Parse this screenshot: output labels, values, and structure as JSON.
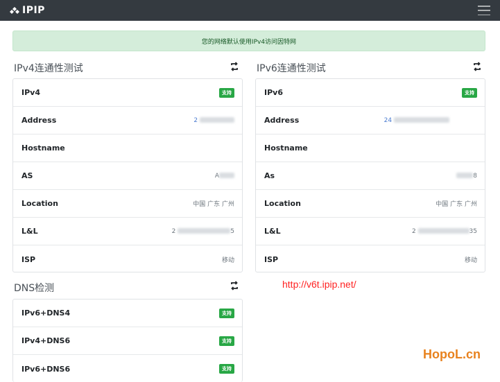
{
  "navbar": {
    "brand": "IPIP",
    "brand_icon": "ipip-logo-icon",
    "menu_icon": "hamburger-icon"
  },
  "alert": {
    "text": "您的网络默认使用IPv4访问因特网",
    "bg": "#d4edda",
    "color": "#155724"
  },
  "ipv4": {
    "title": "IPv4连通性测试",
    "rows": [
      {
        "key": "IPv4",
        "badge": "支持"
      },
      {
        "key": "Address",
        "value": "2"
      },
      {
        "key": "Hostname",
        "value": ""
      },
      {
        "key": "AS",
        "value": "A",
        "value_suffix": ""
      },
      {
        "key": "Location",
        "value": "中国 广东 广州"
      },
      {
        "key": "L&L",
        "value": "2",
        "value_suffix": "5"
      },
      {
        "key": "ISP",
        "value": "移动"
      }
    ]
  },
  "ipv6": {
    "title": "IPv6连通性测试",
    "rows": [
      {
        "key": "IPv6",
        "badge": "支持"
      },
      {
        "key": "Address",
        "value": "24"
      },
      {
        "key": "Hostname",
        "value": ""
      },
      {
        "key": "As",
        "value": "",
        "value_suffix": "8"
      },
      {
        "key": "Location",
        "value": "中国 广东 广州"
      },
      {
        "key": "L&L",
        "value": "2",
        "value_suffix": "35"
      },
      {
        "key": "ISP",
        "value": "移动"
      }
    ]
  },
  "dns": {
    "title": "DNS检测",
    "rows": [
      {
        "key": "IPv6+DNS4",
        "badge": "支持"
      },
      {
        "key": "IPv4+DNS6",
        "badge": "支持"
      },
      {
        "key": "IPv6+DNS6",
        "badge": "支持"
      }
    ]
  },
  "link": {
    "text": "http://v6t.ipip.net/",
    "color": "#ff2222"
  },
  "watermark": {
    "text": "HopoL.cn",
    "color": "#e8821e"
  },
  "badge_color": "#28a745"
}
